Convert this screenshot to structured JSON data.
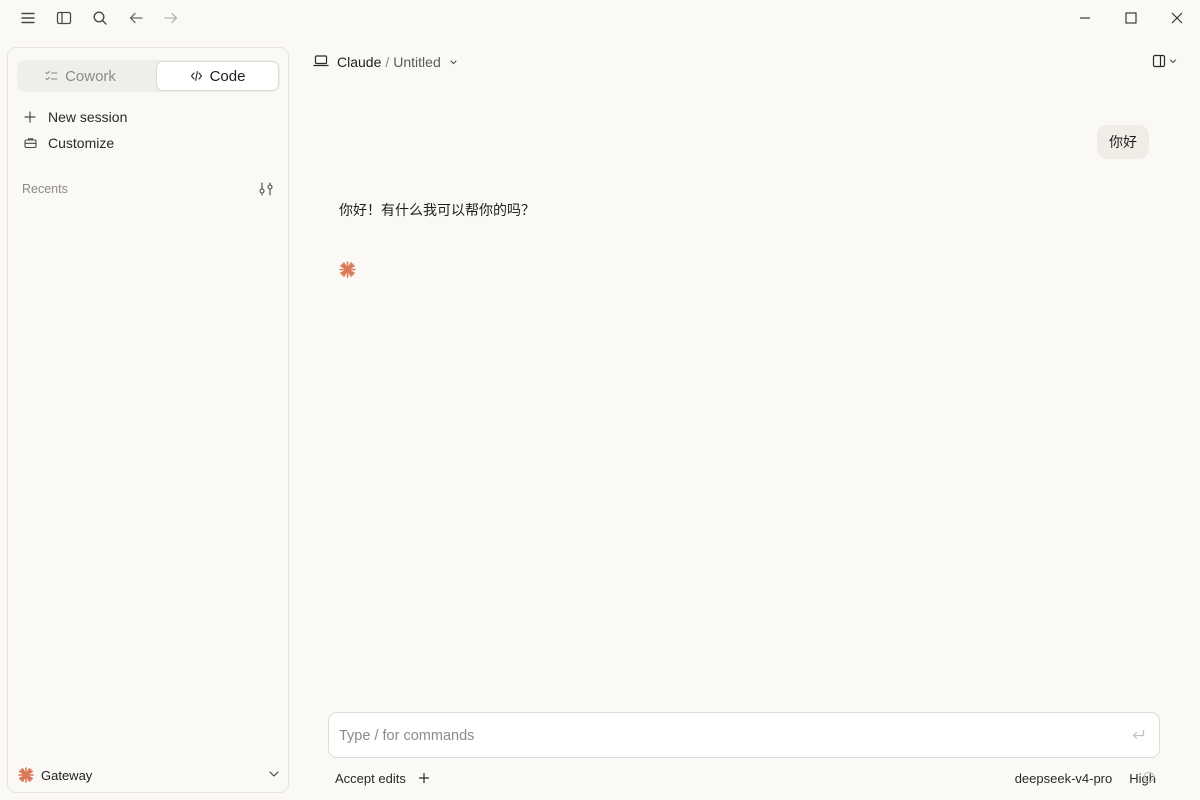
{
  "titlebar": {
    "icons": [
      "menu-icon",
      "sidebar-icon",
      "search-icon",
      "back-arrow-icon",
      "forward-arrow-icon"
    ],
    "window_controls": [
      "minimize-icon",
      "maximize-icon",
      "close-icon"
    ]
  },
  "sidebar": {
    "modes": [
      {
        "label": "Cowork",
        "icon": "checklist-icon",
        "active": false
      },
      {
        "label": "Code",
        "icon": "code-icon",
        "active": true
      }
    ],
    "nav": [
      {
        "label": "New session",
        "icon": "plus-icon"
      },
      {
        "label": "Customize",
        "icon": "briefcase-icon"
      }
    ],
    "recents_label": "Recents",
    "footer": {
      "label": "Gateway",
      "icon": "spark-icon"
    }
  },
  "header": {
    "project": "Claude",
    "separator": "/",
    "title": "Untitled"
  },
  "conversation": {
    "user_message": "你好",
    "assistant_message": "你好！有什么我可以帮你的吗？"
  },
  "composer": {
    "placeholder": "Type / for commands",
    "value": "",
    "accept_edits": "Accept edits",
    "model": "deepseek-v4-pro",
    "effort": "High"
  },
  "colors": {
    "background": "#faf9f5",
    "accent": "#d97757",
    "border": "#dedcd5"
  }
}
